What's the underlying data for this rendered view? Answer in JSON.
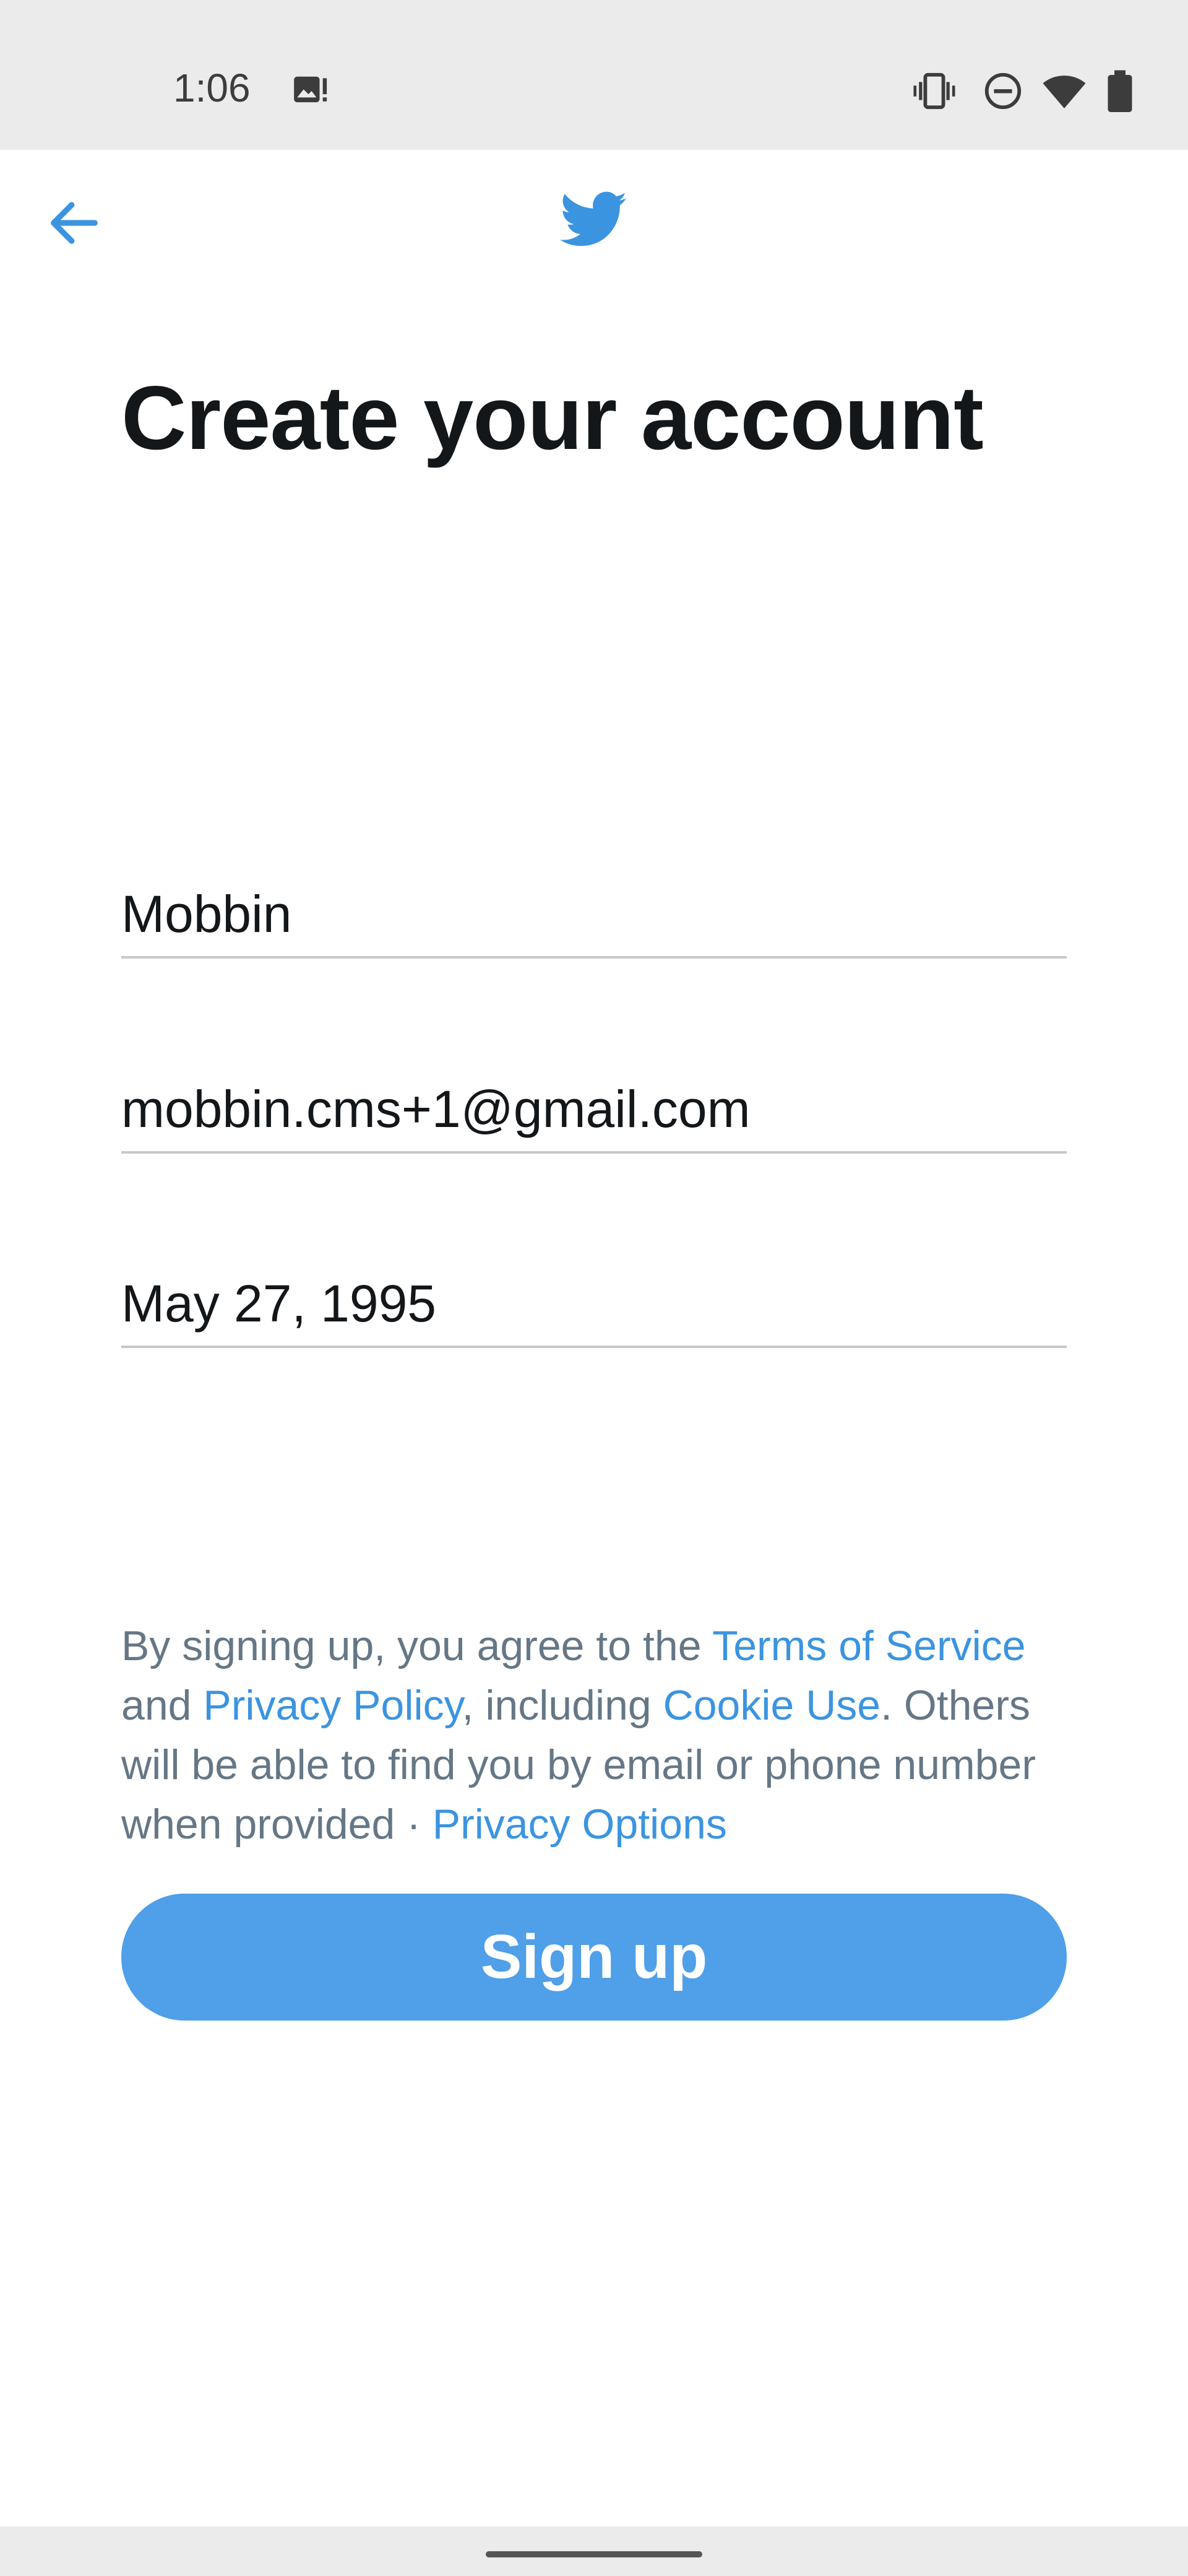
{
  "status_bar": {
    "time": "1:06",
    "icons": [
      "image-notification-icon",
      "vibrate-icon",
      "do-not-disturb-icon",
      "wifi-icon",
      "battery-icon"
    ]
  },
  "app_bar": {
    "back_icon": "arrow-left-icon",
    "logo_icon": "twitter-bird-icon",
    "accent_color": "#4f9fe9"
  },
  "page": {
    "title": "Create your account"
  },
  "form": {
    "name_value": "Mobbin",
    "email_value": "mobbin.cms+1@gmail.com",
    "dob_value": "May 27, 1995"
  },
  "legal": {
    "intro": "By signing up, you agree to the ",
    "terms_link": "Terms of Service",
    "and": " and ",
    "privacy_link": "Privacy Policy",
    "including": ", including ",
    "cookie_link": "Cookie Use",
    "rest": ". Others will be able to find you by email or phone number when provided · ",
    "privacy_options_link": "Privacy Options"
  },
  "actions": {
    "signup_label": "Sign up"
  }
}
